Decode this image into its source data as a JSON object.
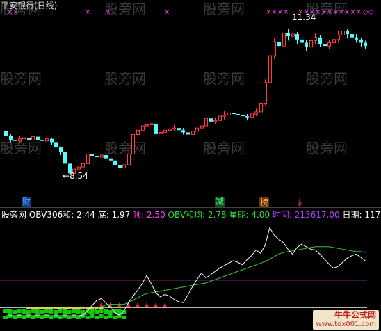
{
  "chart_title": "平安银行(日线)",
  "colors": {
    "up": "#ff3b3b",
    "down": "#54ffff",
    "flat": "#ffffff",
    "magenta": "#ff40ff",
    "obv": "#ffffff",
    "obv_ma": "#30d030",
    "red_tri": "#ff2020",
    "green_block": "#10c810",
    "yellow": "#e0d050",
    "watermark": "#3a3a3a"
  },
  "price_panel": {
    "high_label": "11.34",
    "low_label": "8.54",
    "markers": [
      {
        "text": "财",
        "color": "#5aa0ff",
        "bg": "#123a88"
      },
      {
        "text": "减",
        "color": "#40ff90",
        "bg": "#1a4a20"
      },
      {
        "text": "榜",
        "color": "#ffb040",
        "bg": "#5a3010"
      },
      {
        "text": "$",
        "color": "#ff3030",
        "bg": ""
      }
    ],
    "top_marks": [
      "××",
      "×",
      "×",
      "×",
      "××××",
      "×××××××××××",
      "◇◇"
    ]
  },
  "indicator_header": {
    "name": "股旁网",
    "obv_sum_label": "OBV306和:",
    "obv_sum_value": "2.44",
    "bottom_label": "底:",
    "bottom_value": "1.97",
    "top_label": "顶:",
    "top_value": "2.50",
    "obv_ma_label": "OBV和均:",
    "obv_ma_value": "2.78",
    "week_label": "星期:",
    "week_value": "4.00",
    "time_label": "时间:",
    "time_value": "213617.00",
    "date_label": "日期:",
    "date_value": "11708"
  },
  "watermarks": [
    "股旁网",
    "股旁网",
    "股旁网",
    "股旁网",
    "股旁网",
    "股旁网",
    "股旁网",
    "股旁网",
    "股旁网",
    "股旁网",
    "股旁网",
    "股旁网"
  ],
  "footer": {
    "brand": "牛牛公式网",
    "url": "www.tdx001.com"
  },
  "chart_data": [
    {
      "type": "candlestick",
      "title": "平安银行(日线)",
      "ylim": [
        8.2,
        11.6
      ],
      "candles": [
        [
          9.4,
          9.32,
          9.44,
          9.26
        ],
        [
          9.32,
          9.24,
          9.36,
          9.2
        ],
        [
          9.24,
          9.22,
          9.3,
          9.16
        ],
        [
          9.22,
          9.26,
          9.32,
          9.18
        ],
        [
          9.26,
          9.28,
          9.32,
          9.22
        ],
        [
          9.28,
          9.24,
          9.32,
          9.2
        ],
        [
          9.24,
          9.3,
          9.36,
          9.2
        ],
        [
          9.3,
          9.24,
          9.34,
          9.2
        ],
        [
          9.24,
          9.22,
          9.28,
          9.16
        ],
        [
          9.22,
          9.26,
          9.3,
          9.18
        ],
        [
          9.26,
          9.2,
          9.28,
          9.14
        ],
        [
          9.2,
          9.1,
          9.22,
          9.06
        ],
        [
          9.1,
          9.02,
          9.12,
          8.96
        ],
        [
          9.02,
          8.8,
          9.04,
          8.72
        ],
        [
          8.8,
          8.62,
          8.86,
          8.54
        ],
        [
          8.62,
          8.7,
          8.76,
          8.58
        ],
        [
          8.7,
          8.74,
          8.8,
          8.64
        ],
        [
          8.74,
          8.8,
          8.84,
          8.68
        ],
        [
          8.8,
          8.98,
          9.04,
          8.76
        ],
        [
          8.98,
          8.94,
          9.06,
          8.88
        ],
        [
          8.94,
          8.92,
          9.0,
          8.86
        ],
        [
          8.92,
          8.96,
          9.02,
          8.88
        ],
        [
          8.96,
          8.9,
          9.0,
          8.84
        ],
        [
          8.9,
          8.86,
          8.94,
          8.8
        ],
        [
          8.86,
          8.78,
          8.9,
          8.72
        ],
        [
          8.78,
          8.72,
          8.82,
          8.66
        ],
        [
          8.72,
          8.78,
          8.84,
          8.68
        ],
        [
          8.78,
          8.98,
          9.04,
          8.76
        ],
        [
          8.98,
          9.34,
          9.4,
          8.96
        ],
        [
          9.34,
          9.42,
          9.48,
          9.28
        ],
        [
          9.42,
          9.5,
          9.56,
          9.36
        ],
        [
          9.5,
          9.52,
          9.6,
          9.42
        ],
        [
          9.52,
          9.54,
          9.6,
          9.46
        ],
        [
          9.54,
          9.36,
          9.56,
          9.32
        ],
        [
          9.36,
          9.38,
          9.44,
          9.32
        ],
        [
          9.38,
          9.42,
          9.48,
          9.34
        ],
        [
          9.42,
          9.44,
          9.5,
          9.38
        ],
        [
          9.44,
          9.46,
          9.52,
          9.4
        ],
        [
          9.46,
          9.42,
          9.5,
          9.36
        ],
        [
          9.42,
          9.38,
          9.46,
          9.34
        ],
        [
          9.38,
          9.34,
          9.42,
          9.3
        ],
        [
          9.34,
          9.4,
          9.46,
          9.32
        ],
        [
          9.4,
          9.46,
          9.52,
          9.36
        ],
        [
          9.46,
          9.5,
          9.56,
          9.42
        ],
        [
          9.5,
          9.64,
          9.7,
          9.46
        ],
        [
          9.64,
          9.58,
          9.7,
          9.52
        ],
        [
          9.58,
          9.6,
          9.66,
          9.54
        ],
        [
          9.6,
          9.68,
          9.74,
          9.56
        ],
        [
          9.68,
          9.7,
          9.78,
          9.62
        ],
        [
          9.7,
          9.74,
          9.8,
          9.66
        ],
        [
          9.74,
          9.72,
          9.8,
          9.66
        ],
        [
          9.72,
          9.7,
          9.76,
          9.64
        ],
        [
          9.7,
          9.68,
          9.74,
          9.62
        ],
        [
          9.68,
          9.66,
          9.72,
          9.6
        ],
        [
          9.66,
          9.72,
          9.78,
          9.62
        ],
        [
          9.72,
          9.76,
          9.82,
          9.68
        ],
        [
          9.76,
          9.92,
          9.98,
          9.72
        ],
        [
          9.92,
          10.3,
          10.36,
          9.88
        ],
        [
          10.3,
          10.8,
          10.86,
          10.26
        ],
        [
          10.8,
          11.06,
          11.12,
          10.74
        ],
        [
          11.06,
          10.98,
          11.14,
          10.9
        ],
        [
          10.98,
          11.22,
          11.3,
          10.94
        ],
        [
          11.22,
          11.16,
          11.3,
          11.08
        ],
        [
          11.16,
          11.2,
          11.34,
          11.1
        ],
        [
          11.2,
          11.1,
          11.24,
          11.02
        ],
        [
          11.1,
          11.04,
          11.16,
          10.98
        ],
        [
          11.04,
          10.96,
          11.1,
          10.88
        ],
        [
          10.96,
          11.08,
          11.14,
          10.92
        ],
        [
          11.08,
          11.14,
          11.22,
          11.02
        ],
        [
          11.14,
          11.02,
          11.18,
          10.96
        ],
        [
          11.02,
          10.98,
          11.08,
          10.9
        ],
        [
          10.98,
          11.04,
          11.1,
          10.92
        ],
        [
          11.04,
          11.1,
          11.16,
          10.98
        ],
        [
          11.1,
          11.18,
          11.26,
          11.04
        ],
        [
          11.18,
          11.26,
          11.32,
          11.12
        ],
        [
          11.26,
          11.2,
          11.3,
          11.12
        ],
        [
          11.2,
          11.14,
          11.24,
          11.06
        ],
        [
          11.14,
          11.1,
          11.2,
          11.04
        ],
        [
          11.1,
          11.04,
          11.14,
          10.96
        ],
        [
          11.04,
          10.98,
          11.08,
          10.92
        ]
      ]
    },
    {
      "type": "line",
      "series": [
        {
          "values": [
            1.1,
            1.1,
            1.1,
            1.1,
            1.1,
            1.1,
            1.1,
            1.1,
            1.1,
            1.1,
            1.1,
            1.1,
            1.1,
            1.1,
            1.1,
            1.1,
            1.1,
            1.12,
            1.22,
            1.35,
            1.47,
            1.52,
            1.42,
            1.3,
            1.18,
            1.12,
            1.22,
            1.42,
            1.58,
            1.72,
            1.88,
            2.08,
            1.88,
            1.66,
            1.56,
            1.62,
            1.58,
            1.5,
            1.44,
            1.42,
            1.6,
            1.8,
            1.98,
            2.14,
            2.02,
            2.1,
            2.18,
            2.26,
            2.32,
            2.38,
            2.44,
            2.4,
            2.34,
            2.46,
            2.56,
            2.7,
            2.62,
            2.82,
            3.24,
            3.06,
            2.96,
            2.88,
            2.72,
            2.6,
            2.76,
            2.84,
            2.78,
            2.72,
            2.7,
            2.6,
            2.48,
            2.36,
            2.26,
            2.3,
            2.4,
            2.5,
            2.56,
            2.6,
            2.52,
            2.44
          ]
        },
        {
          "values": [
            1.05,
            1.05,
            1.05,
            1.05,
            1.05,
            1.05,
            1.05,
            1.05,
            1.05,
            1.05,
            1.05,
            1.05,
            1.05,
            1.05,
            1.05,
            1.06,
            1.08,
            1.1,
            1.14,
            1.2,
            1.26,
            1.32,
            1.36,
            1.38,
            1.38,
            1.38,
            1.38,
            1.42,
            1.48,
            1.54,
            1.6,
            1.64,
            1.66,
            1.68,
            1.7,
            1.72,
            1.74,
            1.76,
            1.78,
            1.8,
            1.82,
            1.84,
            1.86,
            1.88,
            1.9,
            1.94,
            1.98,
            2.02,
            2.06,
            2.1,
            2.14,
            2.18,
            2.22,
            2.26,
            2.3,
            2.34,
            2.38,
            2.42,
            2.48,
            2.54,
            2.6,
            2.64,
            2.66,
            2.68,
            2.7,
            2.72,
            2.74,
            2.76,
            2.78,
            2.78,
            2.78,
            2.78,
            2.76,
            2.74,
            2.72,
            2.7,
            2.68,
            2.66,
            2.66,
            2.64
          ]
        }
      ],
      "ylim": [
        0.9,
        3.3
      ],
      "hlines": [
        1.97,
        1.4
      ]
    }
  ]
}
